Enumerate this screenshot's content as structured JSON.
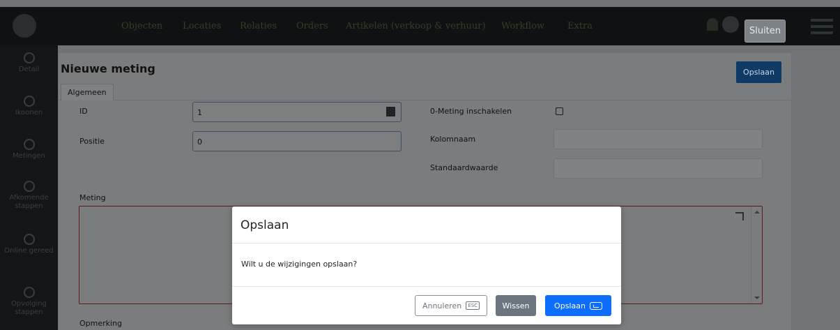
{
  "app": {
    "logo_text": "",
    "nav": [
      "Objecten",
      "Locaties",
      "Relaties",
      "Orders",
      "Artikelen (verkoop & verhuur)",
      "Workflow",
      "Extra"
    ],
    "close_label": "Sluiten",
    "sidebar": [
      "Detail",
      "Ikoonen",
      "Metingen",
      "Afkomende stappen",
      "Online gereed",
      "Opvolging stappen"
    ]
  },
  "edit": {
    "title": "Nieuwe meting",
    "save_label": "Opslaan",
    "tab": "Algemeen",
    "fields": {
      "id_label": "ID",
      "id_value": "1",
      "position_label": "Positie",
      "position_value": "0",
      "zero_label": "0-Meting inschakelen",
      "column_label": "Kolomnaam",
      "default_label": "Standaardwaarde",
      "meting_label": "Meting",
      "remark_label": "Opmerking"
    }
  },
  "confirm": {
    "title": "Opslaan",
    "message": "Wilt u de wijzigingen opslaan?",
    "cancel_label": "Annuleren",
    "cancel_key": "ESC",
    "clear_label": "Wissen",
    "save_label": "Opslaan"
  },
  "colors": {
    "primary": "#0d6efd",
    "secondary": "#6c757d",
    "overlay": "#6f7376"
  }
}
